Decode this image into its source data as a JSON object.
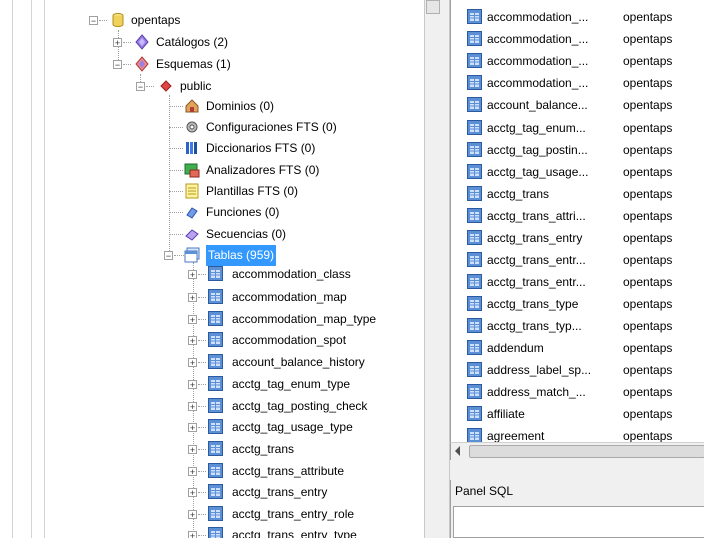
{
  "tree": {
    "database": "opentaps",
    "catalogs": "Catálogos (2)",
    "schemas": "Esquemas (1)",
    "schema_public": "public",
    "groups": [
      {
        "label": "Dominios (0)",
        "icon": "domain-icon"
      },
      {
        "label": "Configuraciones FTS (0)",
        "icon": "fts-config-icon"
      },
      {
        "label": "Diccionarios FTS (0)",
        "icon": "fts-dictionary-icon"
      },
      {
        "label": "Analizadores FTS (0)",
        "icon": "fts-parser-icon"
      },
      {
        "label": "Plantillas FTS (0)",
        "icon": "fts-template-icon"
      },
      {
        "label": "Funciones (0)",
        "icon": "function-icon"
      },
      {
        "label": "Secuencias (0)",
        "icon": "sequence-icon"
      }
    ],
    "tables_label": "Tablas (959)",
    "tables": [
      "accommodation_class",
      "accommodation_map",
      "accommodation_map_type",
      "accommodation_spot",
      "account_balance_history",
      "acctg_tag_enum_type",
      "acctg_tag_posting_check",
      "acctg_tag_usage_type",
      "acctg_trans",
      "acctg_trans_attribute",
      "acctg_trans_entry",
      "acctg_trans_entry_role",
      "acctg_trans_entry_type"
    ]
  },
  "list": {
    "rows": [
      {
        "name": "accommodation_...",
        "owner": "opentaps"
      },
      {
        "name": "accommodation_...",
        "owner": "opentaps"
      },
      {
        "name": "accommodation_...",
        "owner": "opentaps"
      },
      {
        "name": "accommodation_...",
        "owner": "opentaps"
      },
      {
        "name": "account_balance...",
        "owner": "opentaps"
      },
      {
        "name": "acctg_tag_enum...",
        "owner": "opentaps"
      },
      {
        "name": "acctg_tag_postin...",
        "owner": "opentaps"
      },
      {
        "name": "acctg_tag_usage...",
        "owner": "opentaps"
      },
      {
        "name": "acctg_trans",
        "owner": "opentaps"
      },
      {
        "name": "acctg_trans_attri...",
        "owner": "opentaps"
      },
      {
        "name": "acctg_trans_entry",
        "owner": "opentaps"
      },
      {
        "name": "acctg_trans_entr...",
        "owner": "opentaps"
      },
      {
        "name": "acctg_trans_entr...",
        "owner": "opentaps"
      },
      {
        "name": "acctg_trans_type",
        "owner": "opentaps"
      },
      {
        "name": "acctg_trans_typ...",
        "owner": "opentaps"
      },
      {
        "name": "addendum",
        "owner": "opentaps"
      },
      {
        "name": "address_label_sp...",
        "owner": "opentaps"
      },
      {
        "name": "address_match_...",
        "owner": "opentaps"
      },
      {
        "name": "affiliate",
        "owner": "opentaps"
      },
      {
        "name": "agreement",
        "owner": "opentaps"
      }
    ]
  },
  "sql_panel": {
    "title": "Panel SQL"
  },
  "colors": {
    "selection": "#3399ff",
    "table_icon": "#5b8fd6"
  }
}
